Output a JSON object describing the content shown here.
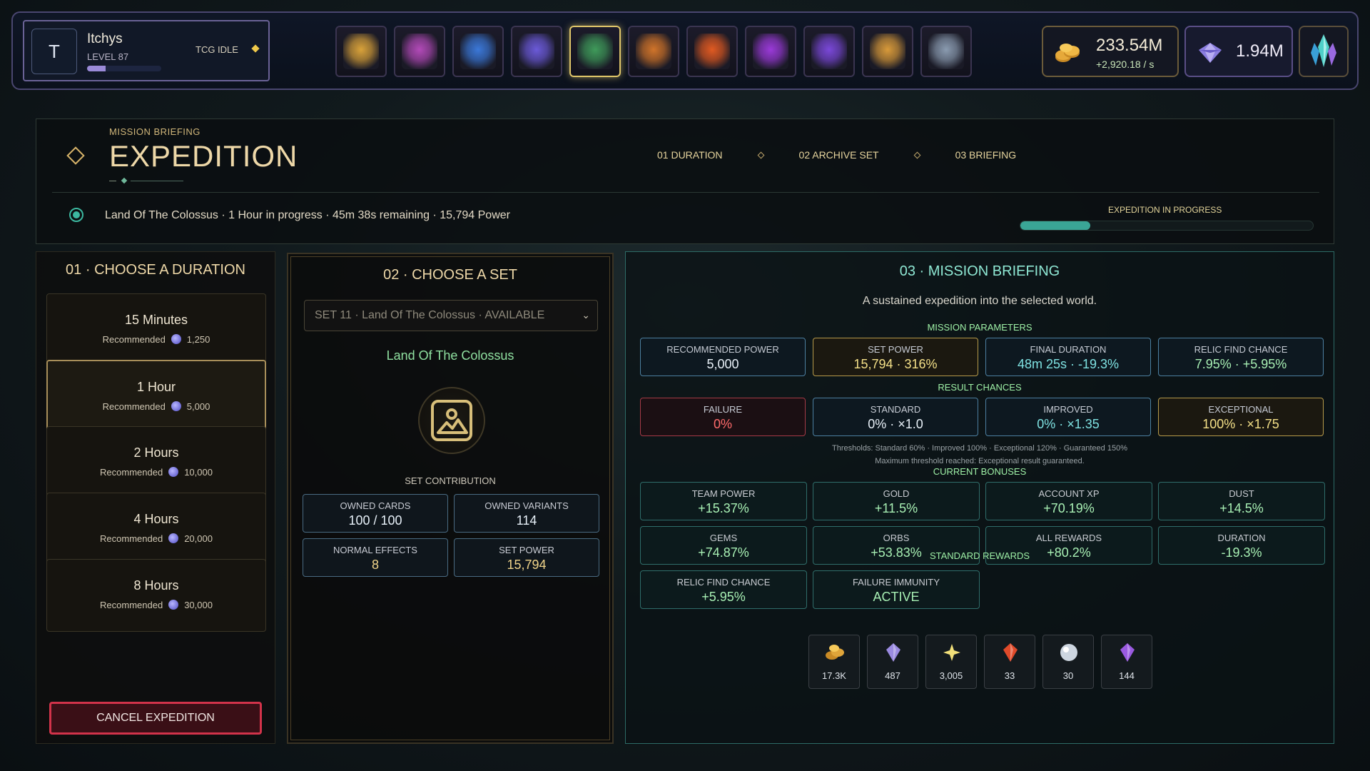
{
  "profile": {
    "avatar_letter": "T",
    "name": "Itchys",
    "level": "LEVEL 87",
    "game": "TCG IDLE",
    "xp_fraction": 0.25
  },
  "nav": {
    "icons": [
      {
        "name": "castle-icon",
        "color": "#d9a23a",
        "active": false
      },
      {
        "name": "card-pack-icon",
        "color": "#b24ab8",
        "active": false
      },
      {
        "name": "scroll-map-icon",
        "color": "#3b78d8",
        "active": false
      },
      {
        "name": "crystal-sword-icon",
        "color": "#6b5ad8",
        "active": false
      },
      {
        "name": "expedition-compass-icon",
        "color": "#3f9a5a",
        "active": true
      },
      {
        "name": "relic-dome-icon",
        "color": "#d0742a",
        "active": false
      },
      {
        "name": "forge-anvil-icon",
        "color": "#e05a22",
        "active": false
      },
      {
        "name": "constellation-icon",
        "color": "#9a3ad8",
        "active": false
      },
      {
        "name": "stats-chart-icon",
        "color": "#7a48d8",
        "active": false
      },
      {
        "name": "trophy-icon",
        "color": "#d89a3a",
        "active": false
      },
      {
        "name": "settings-gear-icon",
        "color": "#8a9bb0",
        "active": false
      }
    ]
  },
  "resources": {
    "gold": "233.54M",
    "gold_rate": "+2,920.18 / s",
    "gems": "1.94M"
  },
  "header": {
    "kicker": "MISSION BRIEFING",
    "title": "EXPEDITION",
    "steps": [
      "01  DURATION",
      "02  ARCHIVE SET",
      "03  BRIEFING"
    ],
    "status": "Land Of The Colossus · 1 Hour in progress · 45m 38s remaining · 15,794 Power",
    "progress_label": "EXPEDITION IN PROGRESS",
    "progress_fraction": 0.24
  },
  "duration": {
    "title": "01 · CHOOSE A DURATION",
    "options": [
      {
        "name": "15 Minutes",
        "rec_label": "Recommended",
        "rec": "1,250",
        "selected": false
      },
      {
        "name": "1 Hour",
        "rec_label": "Recommended",
        "rec": "5,000",
        "selected": true
      },
      {
        "name": "2 Hours",
        "rec_label": "Recommended",
        "rec": "10,000",
        "selected": false
      },
      {
        "name": "4 Hours",
        "rec_label": "Recommended",
        "rec": "20,000",
        "selected": false
      },
      {
        "name": "8 Hours",
        "rec_label": "Recommended",
        "rec": "30,000",
        "selected": false
      }
    ],
    "cancel_label": "CANCEL EXPEDITION"
  },
  "set": {
    "title": "02 · CHOOSE A SET",
    "selected": "SET 11 · Land Of The Colossus  ·  AVAILABLE",
    "name": "Land Of The Colossus",
    "contribution_label": "SET CONTRIBUTION",
    "stats": [
      {
        "label": "OWNED CARDS",
        "value": "100 / 100"
      },
      {
        "label": "OWNED VARIANTS",
        "value": "114"
      },
      {
        "label": "NORMAL EFFECTS",
        "value": "8"
      },
      {
        "label": "SET POWER",
        "value": "15,794"
      }
    ]
  },
  "briefing": {
    "title": "03 · MISSION BRIEFING",
    "subtitle": "A sustained expedition into the selected world.",
    "params_label": "MISSION PARAMETERS",
    "params": [
      {
        "label": "RECOMMENDED POWER",
        "value": "5,000"
      },
      {
        "label": "SET POWER",
        "value": "15,794 · 316%"
      },
      {
        "label": "FINAL DURATION",
        "value": "48m 25s · -19.3%"
      },
      {
        "label": "RELIC FIND CHANCE",
        "value": "7.95% · +5.95%"
      }
    ],
    "chances_label": "RESULT CHANCES",
    "chances": [
      {
        "label": "FAILURE",
        "value": "0%"
      },
      {
        "label": "STANDARD",
        "value": "0% · ×1.0"
      },
      {
        "label": "IMPROVED",
        "value": "0% · ×1.35"
      },
      {
        "label": "EXCEPTIONAL",
        "value": "100% · ×1.75"
      }
    ],
    "thresholds": "Thresholds: Standard 60% · Improved 100% · Exceptional 120% · Guaranteed 150%",
    "threshold_note": "Maximum threshold reached: Exceptional result guaranteed.",
    "bonuses_label": "CURRENT BONUSES",
    "bonuses": [
      {
        "label": "TEAM POWER",
        "value": "+15.37%"
      },
      {
        "label": "GOLD",
        "value": "+11.5%"
      },
      {
        "label": "ACCOUNT XP",
        "value": "+70.19%"
      },
      {
        "label": "DUST",
        "value": "+14.5%"
      },
      {
        "label": "GEMS",
        "value": "+74.87%"
      },
      {
        "label": "ORBS",
        "value": "+53.83%"
      },
      {
        "label": "ALL REWARDS",
        "value": "+80.2%"
      },
      {
        "label": "DURATION",
        "value": "-19.3%"
      },
      {
        "label": "RELIC FIND CHANCE",
        "value": "+5.95%"
      },
      {
        "label": "FAILURE IMMUNITY",
        "value": "ACTIVE"
      }
    ],
    "rewards_label": "STANDARD REWARDS",
    "rewards": [
      {
        "icon": "gold-coins-icon",
        "count": "17.3K",
        "color": "#e0a53a"
      },
      {
        "icon": "gem-icon",
        "count": "487",
        "color": "#9a8ae0"
      },
      {
        "icon": "dust-sparkle-icon",
        "count": "3,005",
        "color": "#f2e07a"
      },
      {
        "icon": "red-crystal-icon",
        "count": "33",
        "color": "#e04a2a"
      },
      {
        "icon": "silver-orb-icon",
        "count": "30",
        "color": "#cdd6e0"
      },
      {
        "icon": "purple-shard-icon",
        "count": "144",
        "color": "#9a5ae0"
      }
    ]
  }
}
